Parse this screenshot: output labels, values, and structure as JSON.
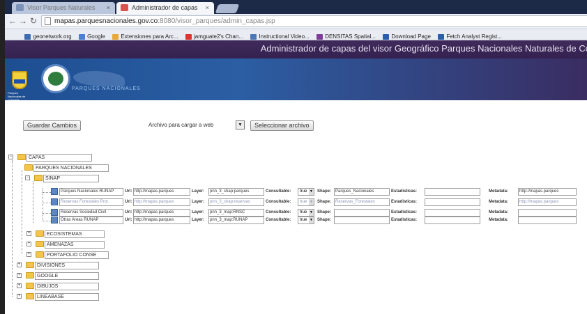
{
  "browser": {
    "tabs": [
      {
        "label": "Visor Parques Naturales",
        "active": false
      },
      {
        "label": "Administrador de capas",
        "active": true
      }
    ],
    "url_host": "mapas.parquesnacionales.gov.co",
    "url_path": ":8080/visor_parques/admin_capas.jsp",
    "bookmarks": [
      {
        "label": "geonetwork.org",
        "color": "#3e6bb0"
      },
      {
        "label": "Google",
        "color": "#4a7fd4"
      },
      {
        "label": "Extensiones para Arc...",
        "color": "#e8a93a"
      },
      {
        "label": "jamguate2's Chan...",
        "color": "#d33"
      },
      {
        "label": "Instructional Video...",
        "color": "#4f77b6"
      },
      {
        "label": "DENSITAS Spatial...",
        "color": "#7d3c98"
      },
      {
        "label": "Download Page",
        "color": "#2a5fa8"
      },
      {
        "label": "Fetch Analyst Regist...",
        "color": "#2a5fa8"
      }
    ]
  },
  "page": {
    "banner_title": "Administrador de capas del visor Geográfico Parques Nacionales Naturales de Co",
    "logo_text": "PARQUES NACIONALES",
    "shield_text": "Parques Nacionales de Colombia"
  },
  "controls": {
    "save_button": "Guardar Cambios",
    "file_select": "Archivo para cargar a web",
    "select_file_button": "Seleccionar archivo"
  },
  "tree": {
    "root": "CAPAS",
    "groups": [
      {
        "label": "PARQUES NACIONALES"
      },
      {
        "label": "SINAP"
      },
      {
        "label": "ECOSISTEMAS"
      },
      {
        "label": "AMENAZAS"
      },
      {
        "label": "PORTAFOLIO CONSE"
      },
      {
        "label": "DIVISIONES"
      },
      {
        "label": "GOOGLE"
      },
      {
        "label": "DIBUJOS"
      },
      {
        "label": "LINEABASE"
      }
    ],
    "field_labels": {
      "url": "Url:",
      "layer": "Layer:",
      "queryable": "Consultable:",
      "shape": "Shape:",
      "statistics": "Estadisticas:",
      "metadata": "Metadata:"
    },
    "layers": [
      {
        "name": "Parques Nacionales RUNAP",
        "url": "http://mapas.parques",
        "layer": "pnn_3_shap:parques",
        "queryable": "true",
        "shape": "Parques_Nacionales",
        "statistics": "",
        "metadata": "http://mapas.parques"
      },
      {
        "name": "Reservas Forestales Prot.",
        "url": "http://mapas.parques",
        "layer": "pnn_3_shap:reservas",
        "queryable": "true",
        "shape": "Reservas_Forestales",
        "statistics": "",
        "metadata": "http://mapas.parques"
      },
      {
        "name": "Reservas Sociedad Civil",
        "url": "http://mapas.parques",
        "layer": "pnn_3_map:RNSC",
        "queryable": "true",
        "shape": "",
        "statistics": "",
        "metadata": ""
      },
      {
        "name": "Otras Areas RUNAP",
        "url": "http://mapas.parques",
        "layer": "pnn_3_map:RUNAP",
        "queryable": "true",
        "shape": "",
        "statistics": "",
        "metadata": ""
      }
    ]
  }
}
